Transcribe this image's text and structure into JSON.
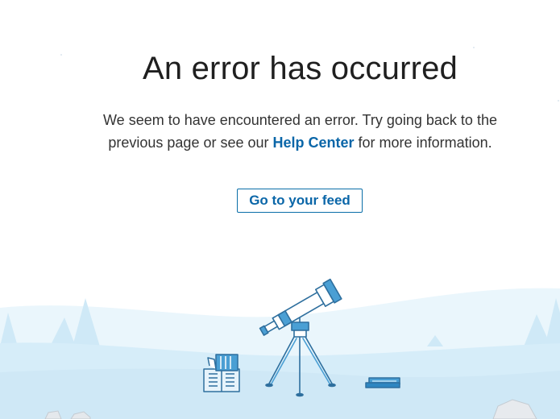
{
  "error": {
    "title": "An error has occurred",
    "message_before_link": "We seem to have encountered an error. Try going back to the previous page or see our ",
    "help_link_label": "Help Center",
    "message_after_link": " for more information."
  },
  "actions": {
    "feed_button_label": "Go to your feed"
  },
  "illustration": {
    "icons": [
      "telescope-icon",
      "book-icon",
      "tablet-icon",
      "tree-icon",
      "rock-icon"
    ]
  },
  "colors": {
    "link": "#0a66a8",
    "button_border": "#0a6ea8",
    "snow": "#d6edf9",
    "illustration_stroke": "#2e6f9e"
  }
}
